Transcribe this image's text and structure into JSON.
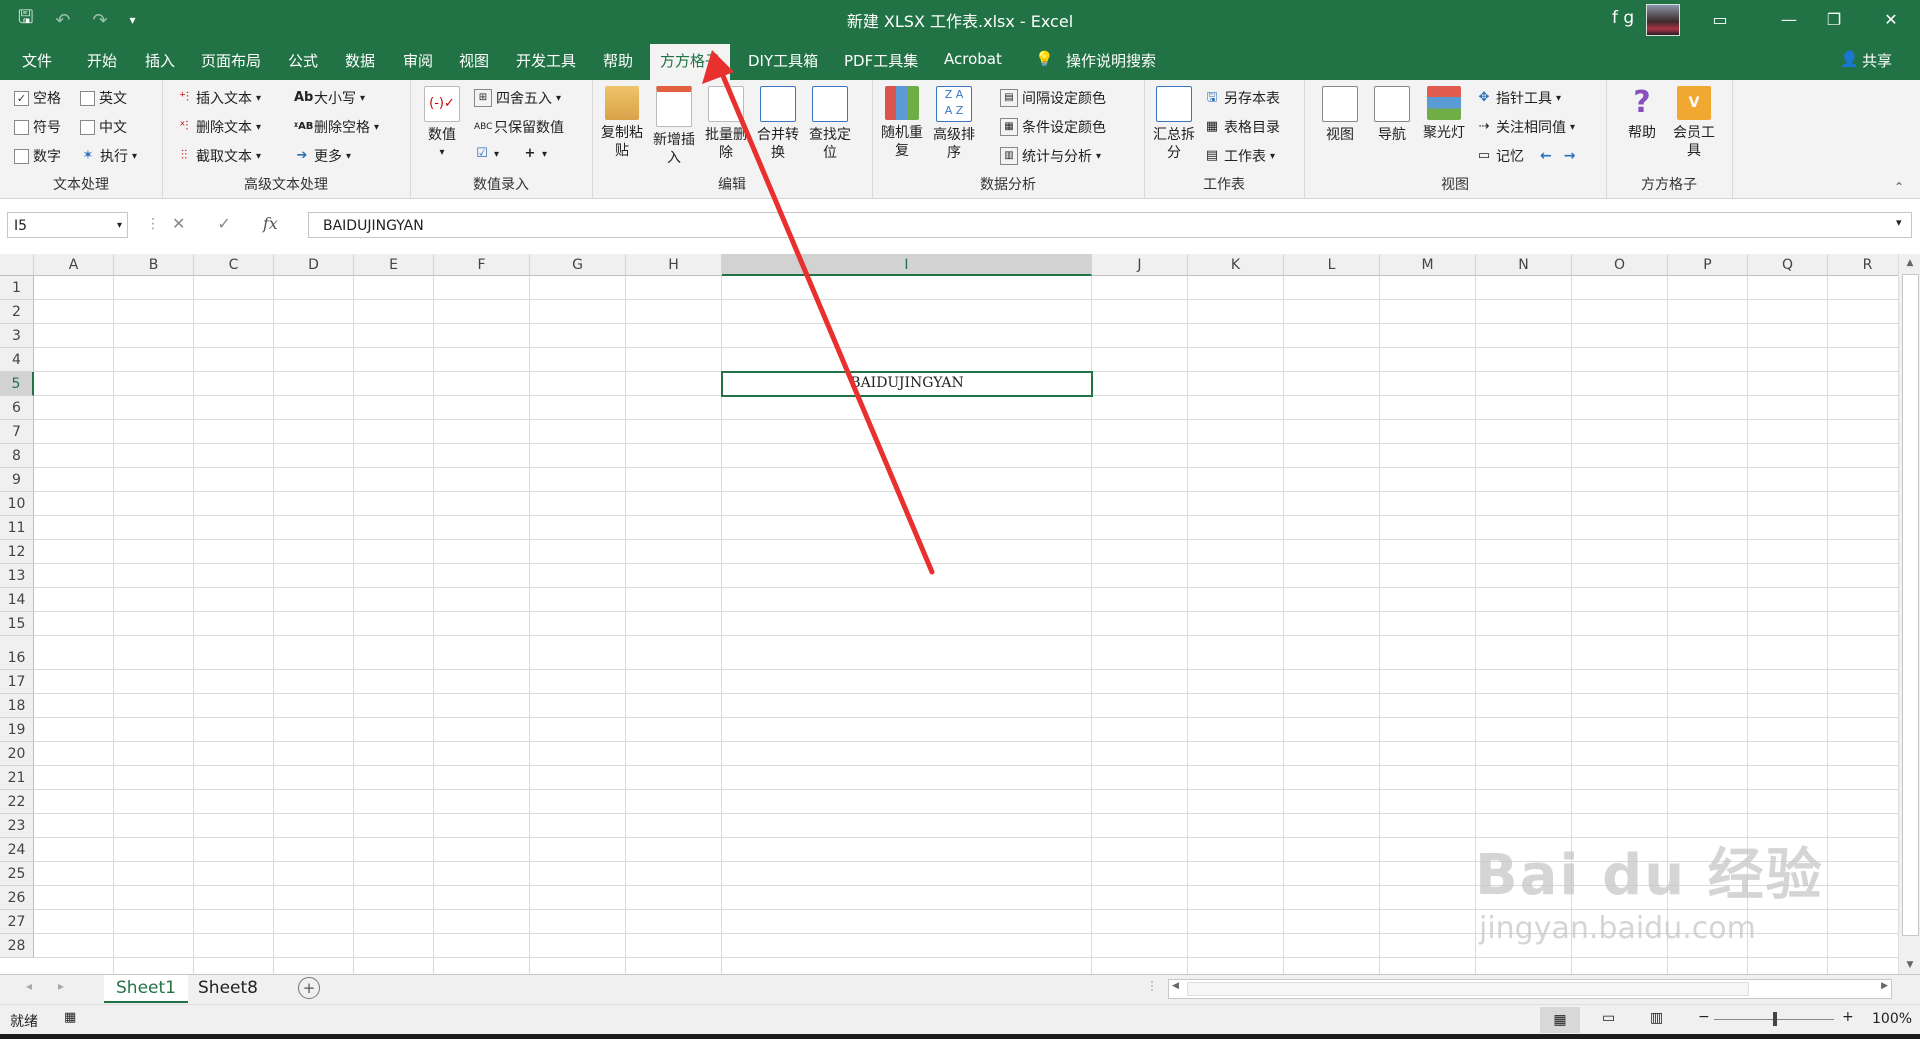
{
  "window": {
    "title": "新建 XLSX 工作表.xlsx  -  Excel",
    "user": "f g"
  },
  "tabs": [
    "文件",
    "开始",
    "插入",
    "页面布局",
    "公式",
    "数据",
    "审阅",
    "视图",
    "开发工具",
    "帮助",
    "方方格子",
    "DIY工具箱",
    "PDF工具集",
    "Acrobat",
    "操作说明搜索"
  ],
  "share_label": "共享",
  "ribbon": {
    "text_group": {
      "label": "文本处理",
      "checks": [
        "空格",
        "英文",
        "符号",
        "中文",
        "数字"
      ],
      "exec": "执行"
    },
    "adv_text": {
      "label": "高级文本处理",
      "items": [
        "插入文本",
        "删除文本",
        "截取文本",
        "大小写",
        "删除空格",
        "更多"
      ]
    },
    "number_input": {
      "label": "数值录入",
      "big": "数值",
      "items": [
        "四舍五入",
        "只保留数值"
      ]
    },
    "edit": {
      "label": "编辑",
      "big": [
        "复制粘贴",
        "新增插入",
        "批量删除",
        "合并转换",
        "查找定位"
      ]
    },
    "data_analysis": {
      "label": "数据分析",
      "big": [
        "随机重复",
        "高级排序"
      ],
      "items": [
        "间隔设定颜色",
        "条件设定颜色",
        "统计与分析"
      ]
    },
    "worksheet": {
      "label": "工作表",
      "big": "汇总拆分",
      "items": [
        "另存本表",
        "表格目录",
        "工作表"
      ]
    },
    "view": {
      "label": "视图",
      "big": [
        "视图",
        "导航",
        "聚光灯"
      ],
      "items": [
        "指针工具",
        "关注相同值",
        "记忆"
      ]
    },
    "ffgz": {
      "label": "方方格子",
      "big": [
        "帮助",
        "会员工具"
      ]
    }
  },
  "formula_bar": {
    "name_box": "I5",
    "formula": "BAIDUJINGYAN"
  },
  "columns": [
    "A",
    "B",
    "C",
    "D",
    "E",
    "F",
    "G",
    "H",
    "I",
    "J",
    "K",
    "L",
    "M",
    "N",
    "O",
    "P",
    "Q",
    "R"
  ],
  "rows": [
    "1",
    "2",
    "3",
    "4",
    "5",
    "6",
    "7",
    "8",
    "9",
    "10",
    "11",
    "12",
    "13",
    "14",
    "15",
    "16",
    "17",
    "18",
    "19",
    "20",
    "21",
    "22",
    "23",
    "24",
    "25",
    "26",
    "27",
    "28"
  ],
  "active_cell": {
    "ref": "I5",
    "value": "BAIDUJINGYAN"
  },
  "sheets": [
    "Sheet1",
    "Sheet8"
  ],
  "status": {
    "ready": "就绪",
    "zoom": "100%"
  },
  "watermark": {
    "brand": "Bai du 经验",
    "url": "jingyan.baidu.com"
  },
  "colors": {
    "accent": "#217346",
    "arrow": "#e8302f"
  }
}
